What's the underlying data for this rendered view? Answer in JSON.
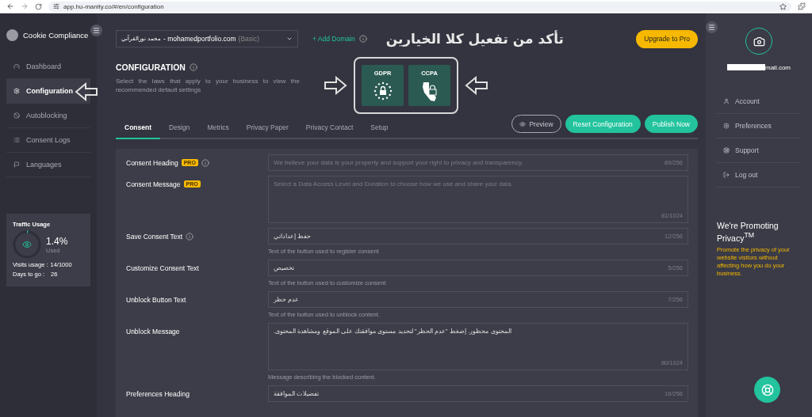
{
  "browser": {
    "url": "app.hu-manity.co/#/en/configuration"
  },
  "sidebar": {
    "app_name": "Cookie Compliance",
    "nav": [
      {
        "label": "Dashboard",
        "selected": false
      },
      {
        "label": "Configuration",
        "selected": true
      },
      {
        "label": "Autoblocking",
        "selected": false
      },
      {
        "label": "Consent Logs",
        "selected": false
      },
      {
        "label": "Languages",
        "selected": false
      }
    ],
    "traffic": {
      "title": "Traffic Usage",
      "percent": "1.4%",
      "used_label": "Used",
      "level": 0.014,
      "visits_label": "Visits usage :",
      "visits_value": "14/1000",
      "days_label": "Days to go :",
      "days_value": "26"
    }
  },
  "header": {
    "domain_owner": "محمد نورالقرآني",
    "domain": "- mohamedportfolio.com",
    "plan": "(Basic)",
    "add_domain": "+ Add Domain",
    "upgrade": "Upgrade to Pro"
  },
  "annotation": {
    "note": "تأكد من تفعيل كلا الخيارين"
  },
  "config": {
    "title": "CONFIGURATION",
    "description": "Select the laws that apply to your business to view the recommended default settings",
    "laws": [
      {
        "label": "GDPR",
        "kind": "gdpr",
        "selected": true
      },
      {
        "label": "CCPA",
        "kind": "ccpa",
        "selected": true
      }
    ]
  },
  "tabs": [
    {
      "label": "Consent",
      "selected": true
    },
    {
      "label": "Design",
      "selected": false
    },
    {
      "label": "Metrics",
      "selected": false
    },
    {
      "label": "Privacy Paper",
      "selected": false
    },
    {
      "label": "Privacy Contact",
      "selected": false
    },
    {
      "label": "Setup",
      "selected": false
    }
  ],
  "actions": {
    "preview": "Preview",
    "reset": "Reset Configuration",
    "publish": "Publish Now"
  },
  "fields": [
    {
      "label": "Consent Heading",
      "pro_badge": "PRO",
      "info": true,
      "kind": "input",
      "placeholder": "We believe your data is your property and support your right to privacy and transparency.",
      "count": "89/256"
    },
    {
      "label": "Consent Message",
      "pro_badge": "PRO",
      "info": false,
      "kind": "textarea",
      "placeholder": "Select a Data Access Level and Duration to choose how we use and share your data.",
      "count": "81/1024"
    },
    {
      "label": "Save Consent Text",
      "info": true,
      "kind": "input",
      "value": "حفظ إعداداتي",
      "count": "12/256",
      "help": "Text of the button used to register consent"
    },
    {
      "label": "Customize Consent Text",
      "info": false,
      "kind": "input",
      "value": "تخصيص",
      "count": "5/256",
      "help": "Text of the button used to customize consent"
    },
    {
      "label": "Unblock Button Text",
      "info": false,
      "kind": "input",
      "value": "عدم حظر",
      "count": "7/256",
      "help": "Text of the button used to unblock content."
    },
    {
      "label": "Unblock Message",
      "info": false,
      "kind": "textarea",
      "value": "المحتوى محظور. إضغط \"عدم الحظر\" لتحديد مستوى موافقتك على الموقع ومشاهدة المحتوى.",
      "count": "80/1024",
      "help": "Message describing the blocked content."
    },
    {
      "label": "Preferences Heading",
      "info": false,
      "kind": "input",
      "value": "تفضيلات الموافقة",
      "count": "16/256"
    }
  ],
  "account": {
    "email_fragment": "mail.com",
    "menu": [
      {
        "label": "Account"
      },
      {
        "label": "Preferences"
      },
      {
        "label": "Support"
      },
      {
        "label": "Log out"
      }
    ],
    "promo_title": "We're Promoting Privacy$^{TM}$",
    "promo_text": "Promote the privacy of your website visitors without affecting how you do your business."
  }
}
